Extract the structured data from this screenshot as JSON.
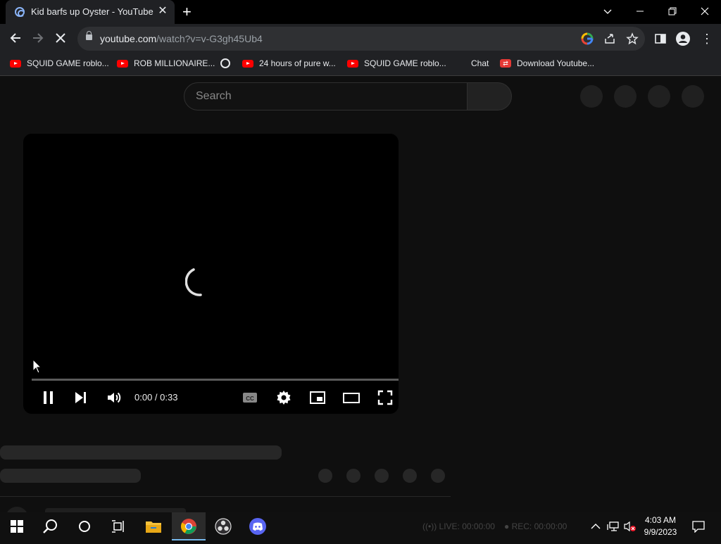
{
  "browser": {
    "tab_title": "Kid barfs up Oyster - YouTube",
    "tab_close": "✕",
    "new_tab": "+",
    "url_host": "youtube.com",
    "url_path": "/watch?v=v-G3gh45Ub4",
    "window_controls": {
      "minimize": "—",
      "restore": "❐",
      "close": "✕",
      "tab_search": "⌄"
    },
    "nav": {
      "back": "←",
      "forward": "→",
      "reload": "✕"
    },
    "more_menu": "⋮",
    "bookmarks": [
      {
        "label": "SQUID GAME roblo...",
        "icon": "youtube-icon"
      },
      {
        "label": "ROB MILLIONAIRE...",
        "icon": "youtube-icon"
      },
      {
        "label": "",
        "icon": "globe-icon"
      },
      {
        "label": "24 hours of pure w...",
        "icon": "youtube-icon"
      },
      {
        "label": "SQUID GAME roblo...",
        "icon": "youtube-icon"
      },
      {
        "label": "Chat",
        "icon": "none"
      },
      {
        "label": "Download Youtube...",
        "icon": "download-icon"
      }
    ]
  },
  "youtube": {
    "search_placeholder": "Search",
    "player": {
      "time": "0:00 / 0:33",
      "progress": 0,
      "state": "loading",
      "cc_label": "CC"
    }
  },
  "taskbar": {
    "time": "4:03 AM",
    "date": "9/9/2023",
    "obs_live": "LIVE: 00:00:00",
    "obs_rec": "REC: 00:00:00",
    "colors": {
      "accent": "#76b9ed",
      "youtube_red": "#ff0000"
    }
  }
}
